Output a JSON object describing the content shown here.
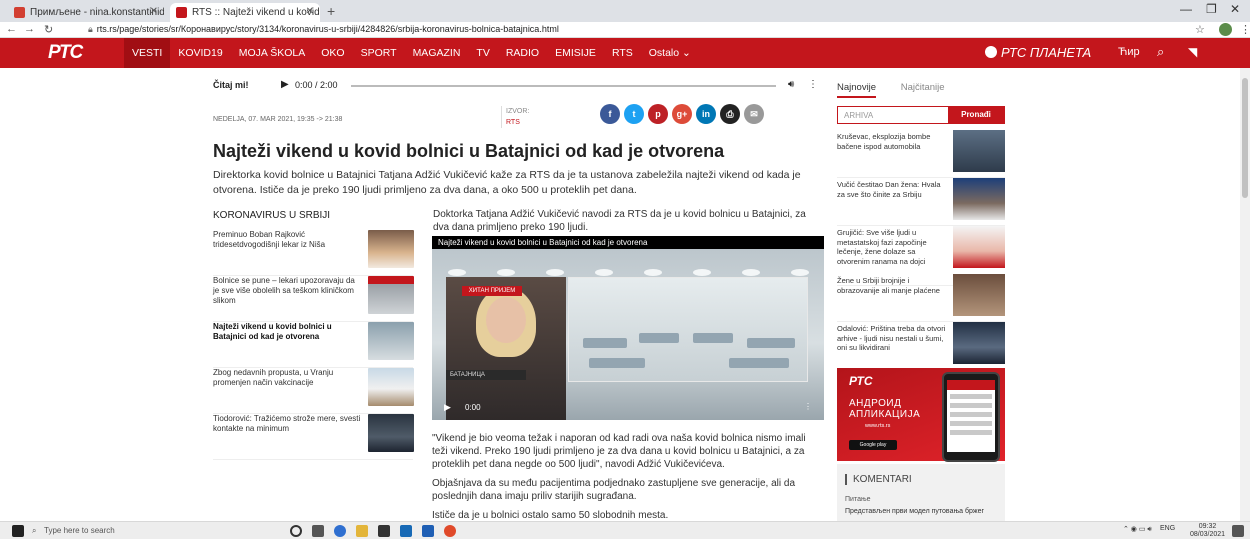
{
  "browser": {
    "tabs": [
      {
        "label": "Примљене - nina.konstantinidis",
        "active": false,
        "favicon_color": "#d23f31"
      },
      {
        "label": "RTS :: Najteži vikend u kovid boln",
        "active": true,
        "favicon_color": "#c3161c"
      }
    ],
    "url": "rts.rs/page/stories/sr/Коронавирус/story/3134/koronavirus-u-srbiji/4284826/srbija-koronavirus-bolnica-batajnica.html"
  },
  "nav": {
    "logo": "РТС",
    "items": [
      "VESTI",
      "KOVID19",
      "MOJA ŠKOLA",
      "OKO",
      "SPORT",
      "MAGAZIN",
      "TV",
      "RADIO",
      "EMISIJE",
      "RTS",
      "Ostalo"
    ],
    "active_index": 0,
    "planeta": "РТС ПЛАНЕТА",
    "lang": "Ћир"
  },
  "player": {
    "label": "Čitaj mi!",
    "time": "0:00 / 2:00"
  },
  "article": {
    "date": "NEDELJA, 07. MAR 2021, 19:35 -> 21:38",
    "source_label": "IZVOR:",
    "source_value": "RTS",
    "headline": "Najteži vikend u kovid bolnici u Batajnici od kad je otvorena",
    "lead": "Direktorka kovid bolnice u Batajnici Tatjana Adžić Vukičević kaže za RTS da je ta ustanova zabeležila najteži vikend od kada je otvorena. Ističe da je preko 190 ljudi primljeno za dva dana, a oko 500 u proteklih pet dana.",
    "body1": "Doktorka Tatjana Adžić Vukičević navodi za RTS da je u kovid bolnicu u Batajnici, za dva dana primljeno preko 190 ljudi.",
    "video_title": "Najteži vikend u kovid bolnici u Batajnici od kad je otvorena",
    "video_time": "0:00",
    "video_caption": "БАТАЈНИЦА",
    "video_sign": "ХИТАН ПРИЈЕМ",
    "quote": "\"Vikend je bio veoma težak i naporan od kad radi ova naša kovid bolnica nismo imali teži vikend. Preko 190 ljudi primljeno je za dva dana u kovid bolnicu u Batajnici, a za proteklih pet dana negde oo 500 ljudi\", navodi Adžić Vukičevićeva.",
    "para2": "Objašnjava da su među pacijentima podjednako zastupljene sve generacije, ali da poslednjih dana imaju priliv starijih sugrađana.",
    "para3": "Ističe da je u bolnici ostalo samo 50 slobodnih mesta."
  },
  "related": {
    "heading": "KORONAVIRUS U SRBIJI",
    "items": [
      {
        "title": "Preminuo Boban Rajković tridesetdvogodišnji lekar iz Niša",
        "bold": false
      },
      {
        "title": "Bolnice se pune – lekari upozoravaju da je sve više obolelih sa teškom kliničkom slikom",
        "bold": false
      },
      {
        "title": "Najteži vikend u kovid bolnici u Batajnici od kad je otvorena",
        "bold": true
      },
      {
        "title": "Zbog nedavnih propusta, u Vranju promenjen način vakcinacije",
        "bold": false
      },
      {
        "title": "Tiodorović: Tražićemo strože mere, svesti kontakte na minimum",
        "bold": false
      }
    ]
  },
  "sidebar": {
    "tab_latest": "Najnovije",
    "tab_most_read": "Najčitanije",
    "search_placeholder": "ARHIVA",
    "search_button": "Pronađi",
    "items": [
      "Kruševac, eksplozija bombe bačene ispod automobila",
      "Vučić čestitao Dan žena: Hvala za sve što činite za Srbiju",
      "Grujičić: Sve više ljudi u metastatskoj fazi započinje lečenje, žene dolaze sa otvorenim ranama na dojci",
      "Žene u Srbiji brojnije i obrazovanije ali manje plaćene",
      "Odalović: Priština treba da otvori arhive - ljudi nisu nestali u šumi, oni su likvidirani"
    ],
    "ad": {
      "logo": "РТС",
      "line1": "АНДРОИД",
      "line2": "АПЛИКАЦИЈА",
      "line3": "www.rts.rs",
      "store": "Google play"
    },
    "comments_heading": "KOMENTARI",
    "comments_sub": "Питање",
    "comments_preview": "Представљен први модел путовања бржег"
  },
  "taskbar": {
    "search_placeholder": "Type here to search",
    "lang": "ENG",
    "time": "09:32",
    "date": "08/03/2021"
  },
  "colors": {
    "brand": "#c3161c"
  }
}
